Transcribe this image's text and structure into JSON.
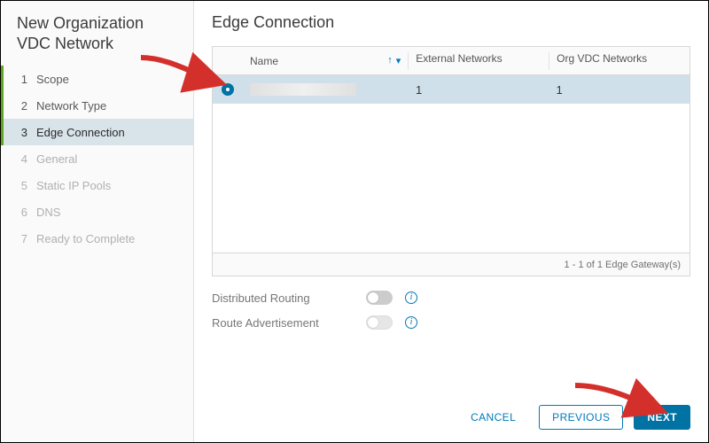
{
  "wizard": {
    "title": "New Organization VDC Network",
    "steps": [
      {
        "num": "1",
        "label": "Scope",
        "state": "done"
      },
      {
        "num": "2",
        "label": "Network Type",
        "state": "done"
      },
      {
        "num": "3",
        "label": "Edge Connection",
        "state": "current"
      },
      {
        "num": "4",
        "label": "General",
        "state": "future"
      },
      {
        "num": "5",
        "label": "Static IP Pools",
        "state": "future"
      },
      {
        "num": "6",
        "label": "DNS",
        "state": "future"
      },
      {
        "num": "7",
        "label": "Ready to Complete",
        "state": "future"
      }
    ]
  },
  "page": {
    "title": "Edge Connection"
  },
  "grid": {
    "columns": {
      "name": "Name",
      "ext": "External Networks",
      "ovn": "Org VDC Networks"
    },
    "rows": [
      {
        "selected": true,
        "name_redacted": true,
        "ext": "1",
        "ovn": "1"
      }
    ],
    "footer": "1 - 1 of 1 Edge Gateway(s)"
  },
  "options": {
    "distributed_routing": {
      "label": "Distributed Routing",
      "on": false
    },
    "route_advertisement": {
      "label": "Route Advertisement",
      "on": false
    }
  },
  "footer": {
    "cancel": "CANCEL",
    "previous": "PREVIOUS",
    "next": "NEXT"
  }
}
